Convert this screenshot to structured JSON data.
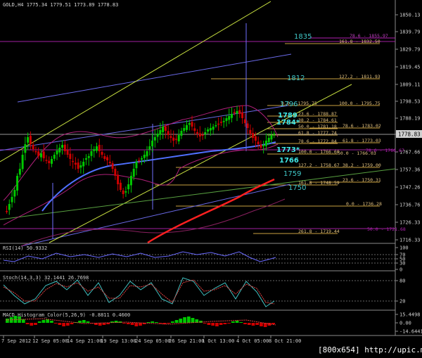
{
  "header": {
    "text": "GOLD,H4  1775.34 1779.51 1773.89 1778.83"
  },
  "watermark": "[800x654] http://upic.me/",
  "colors": {
    "bg": "#000000",
    "bull": "#00c800",
    "bear": "#d00000",
    "axis": "#8a8a8a",
    "fib": "#c8a040",
    "channel": "#7070ff",
    "ma_red": "#ff2020",
    "ma_blue": "#5070ff",
    "band": "#c0208a",
    "green_line": "#c8ff40"
  },
  "price_axis": [
    "1850.13",
    "1839.79",
    "1829.79",
    "1819.45",
    "1809.11",
    "1798.53",
    "1788.19",
    "1778.83",
    "1767.66",
    "1757.36",
    "1747.26",
    "1736.76",
    "1726.33",
    "1716.33"
  ],
  "current_price": "1778.83",
  "right_tags": [
    "78.6 - 1766.67",
    "50.0 - 1721.68"
  ],
  "time_axis": [
    "7 Sep 2012",
    "12 Sep 05:00",
    "14 Sep 21:00",
    "19 Sep 13:00",
    "24 Sep 05:00",
    "26 Sep 21:00",
    "1 Oct 13:00",
    "4 Oct 05:00",
    "8 Oct 21:00"
  ],
  "levels": {
    "l1835": "1835",
    "l1812": "1812",
    "l1796": "1796",
    "l1789": "1789",
    "l1784": "1784*",
    "l1773": "1773*",
    "l1766": "1766",
    "l1759": "1759",
    "l1750": "1750"
  },
  "fib_labels": {
    "a": "161.8 - 1832.50",
    "b": "127.2 - 1811.93",
    "c": "100.0 - 1795.75",
    "d": "0.0 - 1795.75",
    "e": "23.6 - 1788.87",
    "f": "38.2 - 1784.61",
    "g": "50.0 - 1781.18",
    "h": "61.8 - 1777.74",
    "i": "78.6 - 1783.02",
    "j": "78.6 - 1772.84",
    "k": "61.8 - 1773.03",
    "l": "100.0 - 1766.60",
    "m": "50.0 - 1766.03",
    "n": "127.2 - 1758.67",
    "o": "38.2 - 1759.00",
    "p": "161.8 - 1748.59",
    "q": "23.6 - 1750.31",
    "r": "0.0 - 1736.28",
    "s": "261.8 - 1719.44",
    "t": "78.6 - 1855.97"
  },
  "rsi": {
    "title": "RSI(14) 50.9332",
    "ticks": [
      "100",
      "70",
      "50",
      "30",
      "0"
    ]
  },
  "stoch": {
    "title": "Stoch(14,3,3) 32.1441 26.7698",
    "ticks": [
      "80",
      "20"
    ]
  },
  "macd": {
    "title": "MACD_Histogram_Color(5,26,9) -0.8811 0.4600",
    "ticks": [
      "15.4498",
      "0.00",
      "-14.6441"
    ]
  }
}
